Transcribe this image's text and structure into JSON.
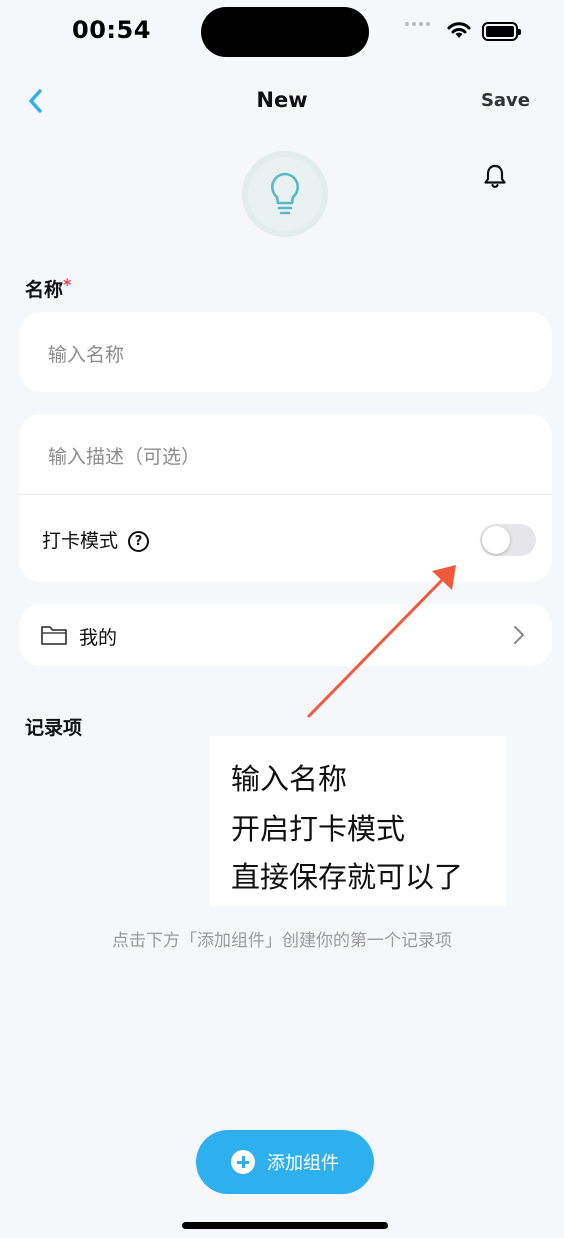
{
  "status_bar": {
    "time": "00:54",
    "battery_level": 1.0
  },
  "nav": {
    "title": "New",
    "save_label": "Save"
  },
  "icons": {
    "back": "chevron-left-icon",
    "bell": "bell-icon",
    "lightbulb": "lightbulb-icon",
    "folder": "folder-icon",
    "chevron_right": "chevron-right-icon",
    "help": "question-circle-icon",
    "plus": "plus-circle-icon"
  },
  "form": {
    "name_label": "名称",
    "name_required_mark": "*",
    "name_placeholder": "输入名称",
    "description_placeholder": "输入描述（可选）",
    "checkin_mode_label": "打卡模式",
    "checkin_mode_help": "?",
    "checkin_mode_enabled": false,
    "folder_label": "我的"
  },
  "records": {
    "title": "记录项",
    "empty_hint": "点击下方「添加组件」创建你的第一个记录项",
    "add_button_label": "添加组件"
  },
  "annotation": {
    "lines": [
      "输入名称",
      "开启打卡模式",
      "直接保存就可以了"
    ],
    "arrow_color": "#f05a3c"
  },
  "colors": {
    "accent": "#2fb0ee",
    "required": "#e5484d",
    "bulb": "#5ab8c4"
  }
}
